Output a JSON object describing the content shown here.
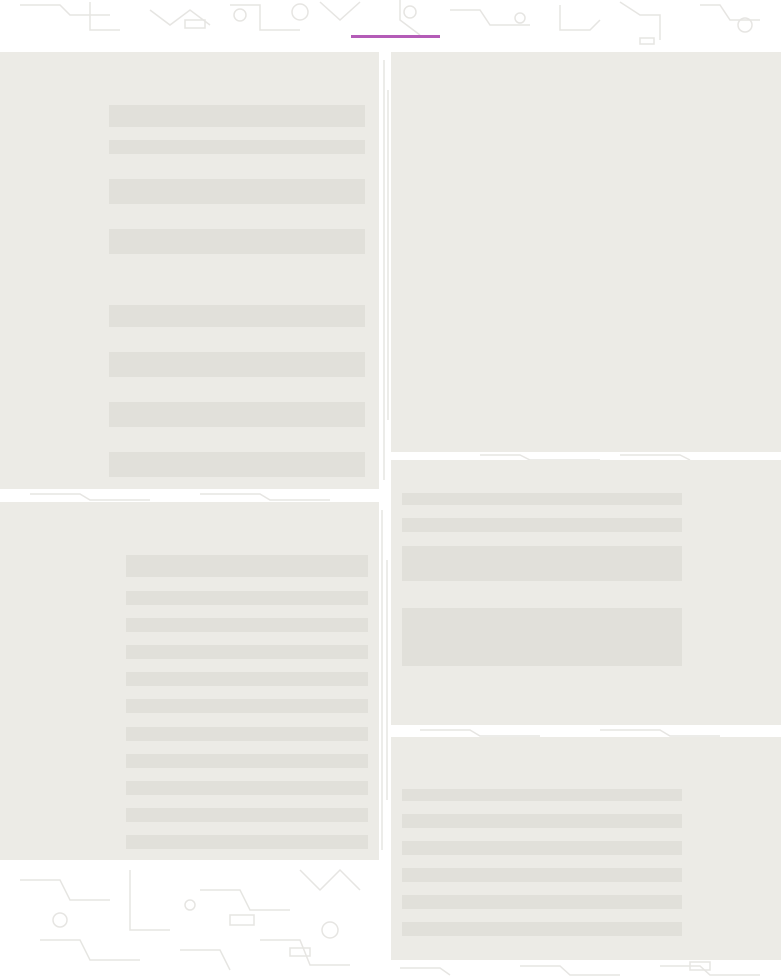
{
  "theme": {
    "background": "#ffffff",
    "panel": "#ecebe6",
    "placeholder_bar": "#e1e0da",
    "circuit_pattern": "#e6e5e2",
    "accent": "#b45cb7"
  },
  "header": {
    "decoration": "circuit-board-pattern",
    "active_tab_indicator": "accent-underline"
  },
  "panels": [
    {
      "id": "panel-top-left",
      "state": "loading-skeleton",
      "placeholder_rows": 8
    },
    {
      "id": "panel-bottom-left",
      "state": "loading-skeleton",
      "placeholder_rows": 11
    },
    {
      "id": "panel-top-right",
      "state": "loading-skeleton",
      "placeholder_rows": 0
    },
    {
      "id": "panel-middle-right",
      "state": "loading-skeleton",
      "placeholder_rows": 4
    },
    {
      "id": "panel-bottom-right",
      "state": "loading-skeleton",
      "placeholder_rows": 6
    }
  ]
}
